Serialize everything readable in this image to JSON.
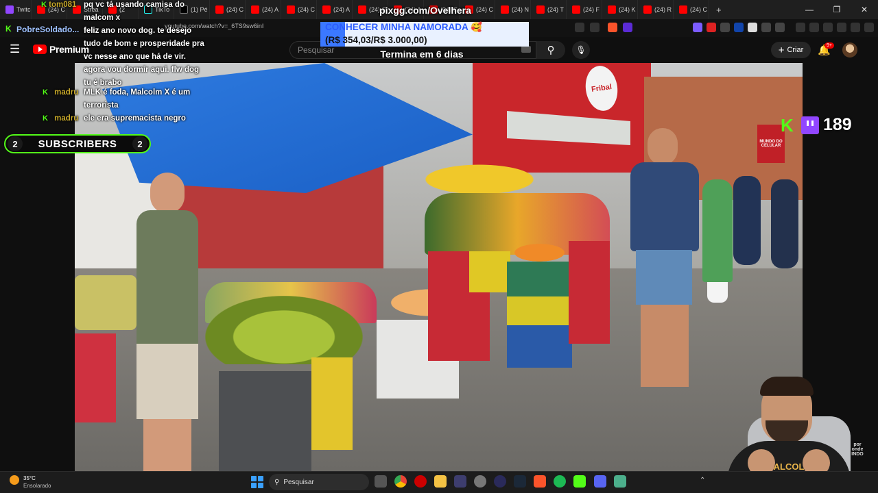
{
  "browser": {
    "tabs": [
      {
        "label": "Twitch",
        "icon": "twitch-icon"
      },
      {
        "label": "(24) C",
        "icon": "youtube-icon"
      },
      {
        "label": "Strea",
        "icon": "youtube-icon"
      },
      {
        "label": "(2",
        "icon": "youtube-icon"
      },
      {
        "label": "TikTo",
        "icon": "tiktok-icon"
      },
      {
        "label": "(1) Pé",
        "icon": "x-icon"
      },
      {
        "label": "(24) C",
        "icon": "youtube-icon"
      },
      {
        "label": "(24) A",
        "icon": "youtube-icon"
      },
      {
        "label": "(24) C",
        "icon": "youtube-icon"
      },
      {
        "label": "(24) A",
        "icon": "youtube-icon"
      },
      {
        "label": "(24) C",
        "icon": "youtube-icon"
      },
      {
        "label": "(24) A",
        "icon": "youtube-icon"
      },
      {
        "label": "(24) C",
        "icon": "youtube-icon"
      },
      {
        "label": "(24) C",
        "icon": "youtube-icon"
      },
      {
        "label": "(24) N",
        "icon": "youtube-icon"
      },
      {
        "label": "(24) T",
        "icon": "youtube-icon"
      },
      {
        "label": "(24) F",
        "icon": "youtube-icon"
      },
      {
        "label": "(24) K",
        "icon": "youtube-icon"
      },
      {
        "label": "(24) R",
        "icon": "youtube-icon"
      },
      {
        "label": "(24) C",
        "icon": "youtube-icon"
      }
    ],
    "new_tab": "+",
    "url": "youtube.com/watch?v=_6TS9sw6inI",
    "window_controls": [
      "—",
      "❐",
      "✕"
    ]
  },
  "youtube": {
    "logo_text": "Premium",
    "search_placeholder": "Pesquisar",
    "create_label": "Criar",
    "notification_badge": "9+"
  },
  "stream_overlay": {
    "pix_url": "pixgg.com/Ovelhera",
    "goal_title": "CONHECER MINHA NAMORADA 🥰",
    "goal_amount": "(R$ 354,03/R$ 3.000,00)",
    "goal_progress": 0.118,
    "goal_ends": "Termina em 6 dias",
    "subscribers_label": "SUBSCRIBERS",
    "subscribers_left": "2",
    "subscribers_right": "2",
    "viewer_count": "189",
    "channel_tag": "PobreSoldado...",
    "watermark": "por onde INDO",
    "chat": [
      {
        "user": "tom081",
        "text": "pq vc tá usando camisa do malcom x"
      },
      {
        "user": "",
        "text": "feliz ano novo dog. te desejo tudo de bom e prosperidade pra vc nesse ano que há de vir. agora vou dormir aqui. flw dog tu é brabo"
      },
      {
        "user": "madru",
        "text": "MLK é foda, Malcolm X é um terrorista"
      },
      {
        "user": "madru",
        "text": "ele era supremacista negro"
      }
    ]
  },
  "video_scene": {
    "store_sign": "Fribal",
    "store_sign2": "MUNDO DO CELULAR"
  },
  "taskbar": {
    "temperature": "35°C",
    "condition": "Ensolarado",
    "search_label": "Pesquisar"
  },
  "colors": {
    "kick_green": "#53fc18",
    "twitch_purple": "#9146ff",
    "youtube_red": "#ff0000"
  }
}
